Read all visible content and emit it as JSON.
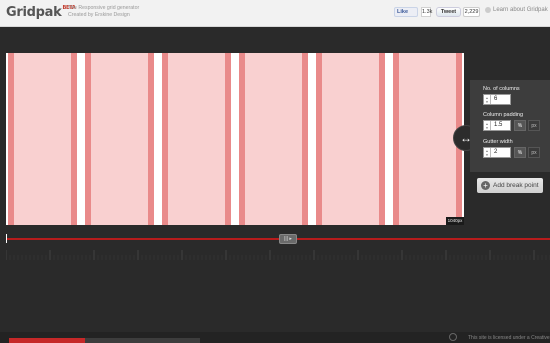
{
  "header": {
    "logo": "Gridpak",
    "logo_badge": "BETA",
    "tagline_line1": "The Responsive grid generator",
    "tagline_line2": "Created by Erskine Design",
    "fb_like_label": "Like",
    "fb_count": "1.3k",
    "tweet_label": "Tweet",
    "tweet_count": "2,229",
    "learn_link": "Learn about Gridpak"
  },
  "grid": {
    "columns": 6,
    "width_label": "1040px"
  },
  "settings": {
    "columns_label": "No. of columns",
    "columns_value": "6",
    "padding_label": "Column padding",
    "padding_value": "1.5",
    "gutter_label": "Gutter width",
    "gutter_value": "2",
    "unit_percent": "%",
    "unit_px": "px",
    "add_breakpoint_label": "Add break point"
  },
  "slider": {
    "knob_label": "||| ▸"
  },
  "footer": {
    "license_text": "This site is licensed under a Creative"
  },
  "colors": {
    "column_fill": "#f9d0d0",
    "column_padding": "#e98a8a",
    "accent": "#b71c1c"
  }
}
